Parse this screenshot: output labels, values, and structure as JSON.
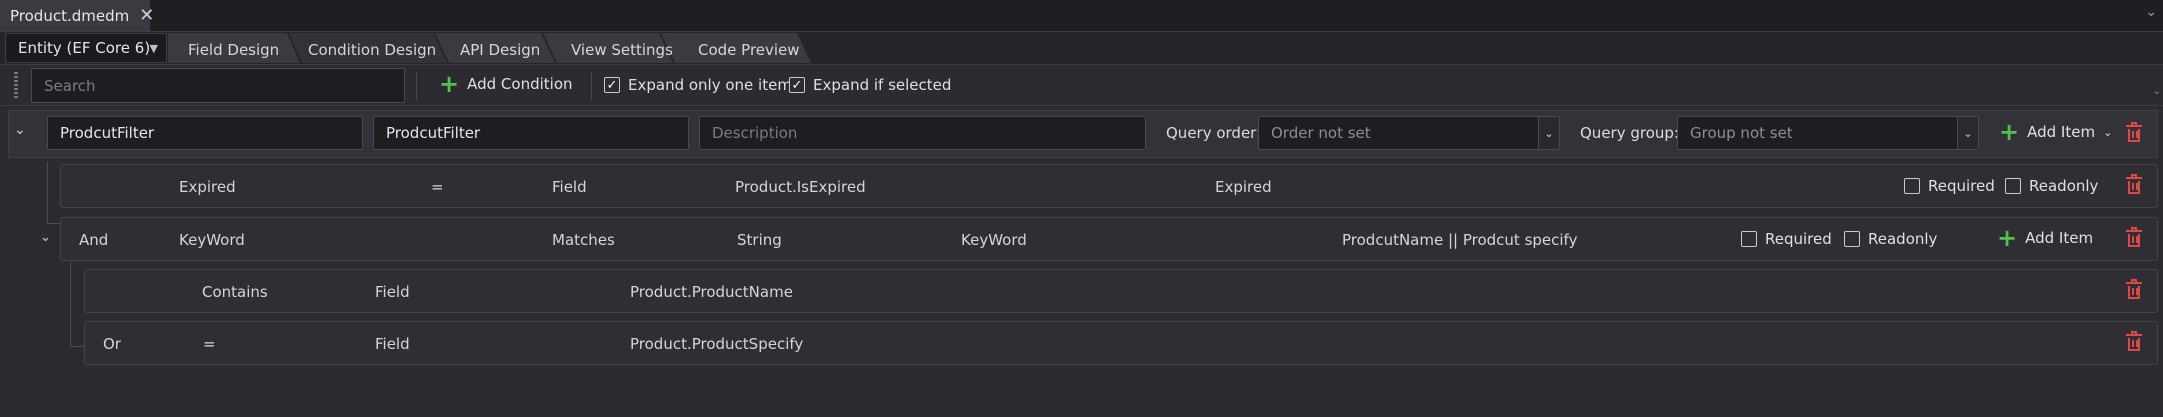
{
  "document_tab": {
    "title": "Product.dmedm",
    "close_glyph": "✕"
  },
  "designer": {
    "entity_select": "Entity (EF Core 6)",
    "tabs": [
      "Field Design",
      "Condition Design",
      "API Design",
      "View Settings",
      "Code Preview"
    ],
    "active_tab": "Condition Design"
  },
  "toolbar": {
    "search_placeholder": "Search",
    "add_condition_label": "Add Condition",
    "expand_one_label": "Expand only one item",
    "expand_one_checked": true,
    "expand_selected_label": "Expand if selected",
    "expand_selected_checked": true
  },
  "filter": {
    "name": "ProdcutFilter",
    "display_name": "ProdcutFilter",
    "description_placeholder": "Description",
    "query_order_label": "Query order:",
    "query_order_value": "Order not set",
    "query_group_label": "Query group:",
    "query_group_value": "Group not set",
    "add_item_label": "Add Item"
  },
  "conditions": [
    {
      "logic": "",
      "name": "Expired",
      "operator": "=",
      "source": "Field",
      "path": "Product.IsExpired",
      "display": "Expired",
      "required_label": "Required",
      "readonly_label": "Readonly"
    },
    {
      "logic": "And",
      "name": "KeyWord",
      "operator": "Matches",
      "source": "String",
      "path": "KeyWord",
      "display": "ProdcutName || Prodcut specify",
      "required_label": "Required",
      "readonly_label": "Readonly",
      "add_item_label": "Add Item",
      "children": [
        {
          "logic": "",
          "operator": "Contains",
          "source": "Field",
          "path": "Product.ProductName"
        },
        {
          "logic": "Or",
          "operator": "=",
          "source": "Field",
          "path": "Product.ProductSpecify"
        }
      ]
    }
  ],
  "icons": {
    "plus": "plus-icon",
    "trash": "trash-icon",
    "chevron": "chevron-down-icon"
  },
  "colors": {
    "accent_green": "#4fc24f",
    "delete_red": "#e04848",
    "background": "#2b2b30"
  }
}
